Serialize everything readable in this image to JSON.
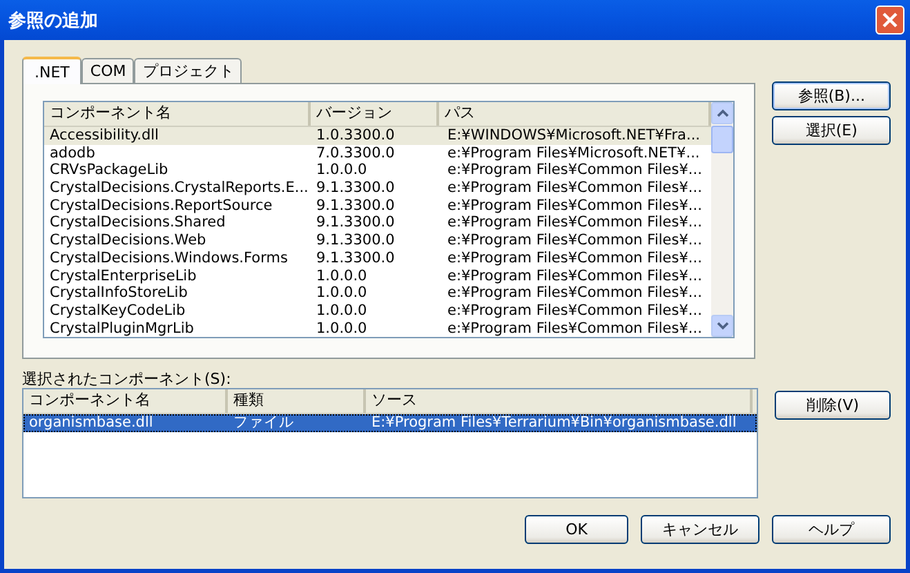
{
  "window": {
    "title": "参照の追加"
  },
  "tabs": [
    {
      "label": ".NET",
      "selected": true
    },
    {
      "label": "COM",
      "selected": false
    },
    {
      "label": "プロジェクト",
      "selected": false
    }
  ],
  "components": {
    "columns": [
      "コンポーネント名",
      "バージョン",
      "パス"
    ],
    "rows": [
      {
        "cells": [
          "Accessibility.dll",
          "1.0.3300.0",
          "E:¥WINDOWS¥Microsoft.NET¥Fra..."
        ],
        "selected": true
      },
      {
        "cells": [
          "adodb",
          "7.0.3300.0",
          "e:¥Program Files¥Microsoft.NET¥..."
        ],
        "selected": false
      },
      {
        "cells": [
          "CRVsPackageLib",
          "1.0.0.0",
          "e:¥Program Files¥Common Files¥..."
        ],
        "selected": false
      },
      {
        "cells": [
          "CrystalDecisions.CrystalReports.E...",
          "9.1.3300.0",
          "e:¥Program Files¥Common Files¥..."
        ],
        "selected": false
      },
      {
        "cells": [
          "CrystalDecisions.ReportSource",
          "9.1.3300.0",
          "e:¥Program Files¥Common Files¥..."
        ],
        "selected": false
      },
      {
        "cells": [
          "CrystalDecisions.Shared",
          "9.1.3300.0",
          "e:¥Program Files¥Common Files¥..."
        ],
        "selected": false
      },
      {
        "cells": [
          "CrystalDecisions.Web",
          "9.1.3300.0",
          "e:¥Program Files¥Common Files¥..."
        ],
        "selected": false
      },
      {
        "cells": [
          "CrystalDecisions.Windows.Forms",
          "9.1.3300.0",
          "e:¥Program Files¥Common Files¥..."
        ],
        "selected": false
      },
      {
        "cells": [
          "CrystalEnterpriseLib",
          "1.0.0.0",
          "e:¥Program Files¥Common Files¥..."
        ],
        "selected": false
      },
      {
        "cells": [
          "CrystalInfoStoreLib",
          "1.0.0.0",
          "e:¥Program Files¥Common Files¥..."
        ],
        "selected": false
      },
      {
        "cells": [
          "CrystalKeyCodeLib",
          "1.0.0.0",
          "e:¥Program Files¥Common Files¥..."
        ],
        "selected": false
      },
      {
        "cells": [
          "CrystalPluginMgrLib",
          "1.0.0.0",
          "e:¥Program Files¥Common Files¥..."
        ],
        "selected": false
      }
    ]
  },
  "side_buttons": [
    "参照(B)...",
    "選択(E)"
  ],
  "selected_label": "選択されたコンポーネント(S):",
  "selected_components": {
    "columns": [
      "コンポーネント名",
      "種類",
      "ソース"
    ],
    "rows": [
      {
        "cells": [
          "organismbase.dll",
          "ファイル",
          "E:¥Program Files¥Terrarium¥Bin¥organismbase.dll"
        ],
        "selected": true
      }
    ]
  },
  "remove_button": "削除(V)",
  "buttons": [
    "OK",
    "キャンセル",
    "ヘルプ"
  ]
}
